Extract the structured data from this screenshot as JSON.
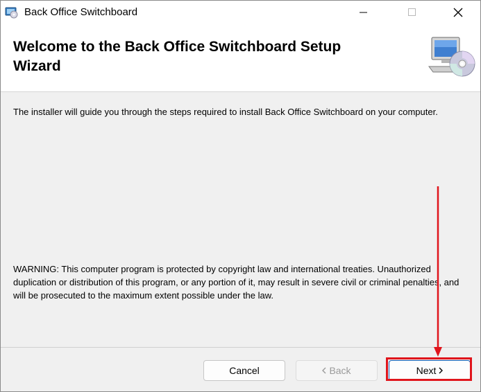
{
  "window": {
    "title": "Back Office Switchboard"
  },
  "header": {
    "title": "Welcome to the Back Office Switchboard Setup Wizard",
    "graphic": "computer-cd-icon"
  },
  "body": {
    "intro": "The installer will guide you through the steps required to install Back Office Switchboard on your computer.",
    "warning": "WARNING: This computer program is protected by copyright law and international treaties. Unauthorized duplication or distribution of this program, or any portion of it, may result in severe civil or criminal penalties, and will be prosecuted to the maximum extent possible under the law."
  },
  "buttons": {
    "cancel": "Cancel",
    "back": "Back",
    "next": "Next"
  },
  "annotation": {
    "color": "#e0151c",
    "target": "next-button"
  }
}
